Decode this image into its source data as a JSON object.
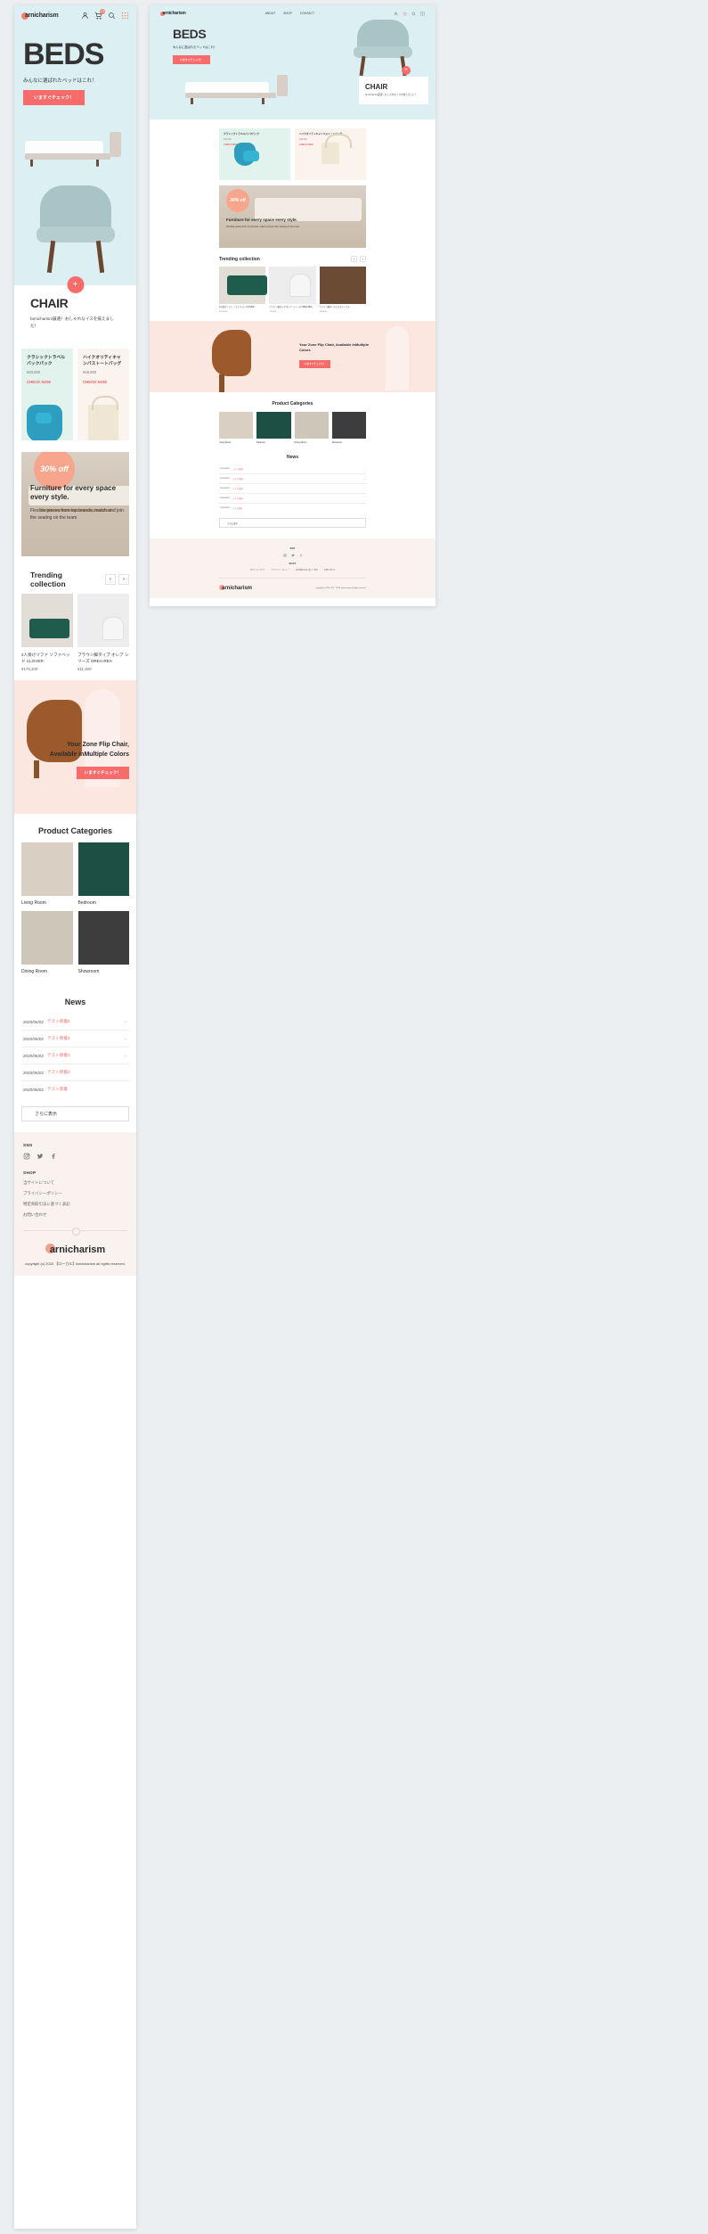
{
  "brand": {
    "name": "arnicharism",
    "full_logo": "farnicharism",
    "accent_coral": "#f86b6b",
    "accent_orange": "#f4806e",
    "hero_bg": "#dcf0f3",
    "pink_bg": "#fbe6e0",
    "footer_bg": "#faf2ef"
  },
  "header": {
    "nav": [
      "ABOUT",
      "SHOP",
      "CONTACT"
    ],
    "icons": [
      {
        "name": "user-icon",
        "label": "Account"
      },
      {
        "name": "cart-icon",
        "label": "Cart",
        "badge": "12"
      },
      {
        "name": "search-icon",
        "label": "Search"
      },
      {
        "name": "menu-grid-icon",
        "label": "Menu"
      }
    ]
  },
  "hero": {
    "title": "BEDS",
    "subtitle": "みんなに選ばれたベッドはこれ！",
    "cta": "いますぐチェック！"
  },
  "chair_card": {
    "plus": "+",
    "title": "CHAIR",
    "description": "farnicharism厳選！おしゃれなイスを揃えました！"
  },
  "promo_cards": [
    {
      "title": "クラシックトラベルバックパック",
      "price": "¥23,000",
      "cta": "CHECK NOW",
      "bg": "#e2f2ec",
      "image": "backpack-image"
    },
    {
      "title": "ハイクオリティキャンバストートバッグ",
      "price": "¥18,000",
      "cta": "CHECK NOW",
      "bg": "#faf3ee",
      "image": "tote-bag-image"
    }
  ],
  "offer_banner": {
    "badge": "30% off",
    "headline": "Furniture for every space every style.",
    "body": "Flexible pieces from top brands, match and join the seating on the team"
  },
  "trending": {
    "section_title": "Trending collection",
    "prev": "‹",
    "next": "›",
    "items": [
      {
        "name": "2人掛けソファ ソファベッド CLOVER",
        "price": "¥175,200",
        "image": "green-sofa-image"
      },
      {
        "name": "ブラウン脚タイプ オレア シリーズ OREA-REA",
        "price": "¥11,000",
        "image": "white-chair-image"
      },
      {
        "name": "アイアン脚オークデスクテーブル",
        "price": "¥39,800",
        "image": "wood-desk-image"
      }
    ]
  },
  "flip_banner": {
    "headline": "Your Zone Flip Chair, Available inMultiple Colors",
    "cta": "いますぐチェック！"
  },
  "categories": {
    "section_title": "Product Categories",
    "items": [
      {
        "label": "Living Room",
        "image": "living-room-image"
      },
      {
        "label": "Bedroom",
        "image": "bedroom-image"
      },
      {
        "label": "Dining Room",
        "image": "dining-room-image"
      },
      {
        "label": "Showroom",
        "image": "showroom-image"
      }
    ]
  },
  "news": {
    "section_title": "News",
    "more": "さらに表示",
    "items": [
      {
        "date": "2020/06/02",
        "title": "テスト新着5"
      },
      {
        "date": "2020/06/02",
        "title": "テスト新着4"
      },
      {
        "date": "2020/06/02",
        "title": "テスト新着3"
      },
      {
        "date": "2020/06/02",
        "title": "テスト新着2"
      },
      {
        "date": "2020/06/02",
        "title": "テスト新着"
      }
    ]
  },
  "footer": {
    "sns_heading": "SNS",
    "shop_heading": "SHOP",
    "social": [
      "instagram-icon",
      "twitter-icon",
      "facebook-icon"
    ],
    "links": [
      "当サイトについて",
      "プライバシーポリシー",
      "特定商取引法に基づく表記",
      "お問い合わせ"
    ],
    "logo": "farnicharism",
    "copyright": "copyright (c) 2020 【ローカル】farnicharism all rights reserved."
  }
}
